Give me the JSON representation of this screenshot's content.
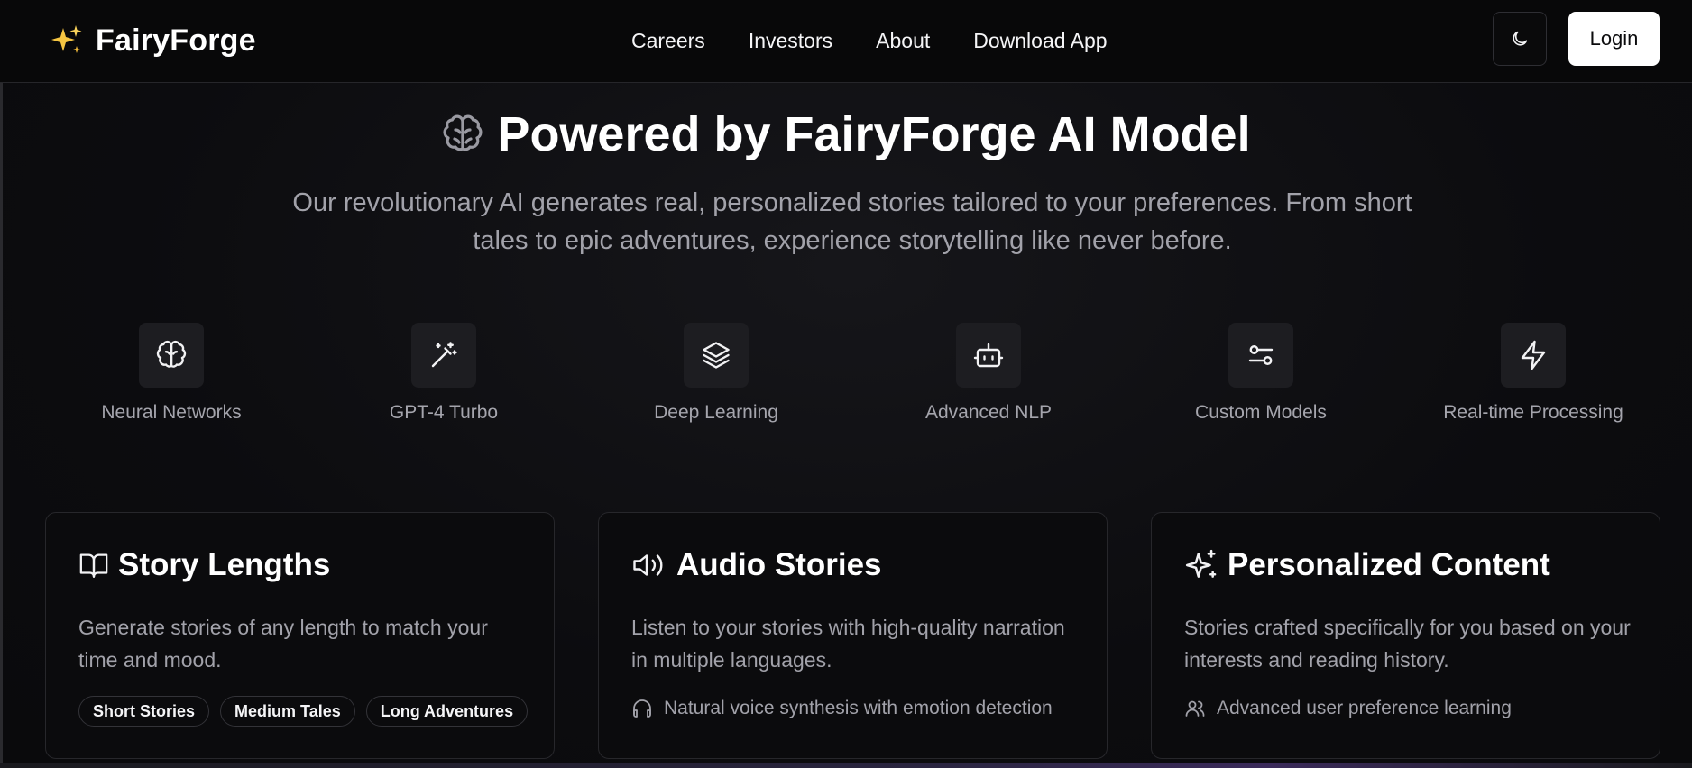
{
  "header": {
    "brand_name": "FairyForge",
    "brand_icon": "sparkles-icon",
    "nav": [
      "Careers",
      "Investors",
      "About",
      "Download App"
    ],
    "theme_toggle_icon": "moon-icon",
    "login_label": "Login"
  },
  "hero": {
    "icon": "brain-icon",
    "title": "Powered by FairyForge AI Model",
    "subtitle": "Our revolutionary AI generates real, personalized stories tailored to your preferences. From short tales to epic adventures, experience storytelling like never before."
  },
  "features": [
    {
      "label": "Neural Networks",
      "icon": "brain-icon"
    },
    {
      "label": "GPT-4 Turbo",
      "icon": "magic-wand-icon"
    },
    {
      "label": "Deep Learning",
      "icon": "layers-icon"
    },
    {
      "label": "Advanced NLP",
      "icon": "bot-icon"
    },
    {
      "label": "Custom Models",
      "icon": "sliders-icon"
    },
    {
      "label": "Real-time Processing",
      "icon": "lightning-icon"
    }
  ],
  "cards": [
    {
      "title": "Story Lengths",
      "icon": "book-open-icon",
      "description": "Generate stories of any length to match your time and mood.",
      "pills": [
        "Short Stories",
        "Medium Tales",
        "Long Adventures"
      ]
    },
    {
      "title": "Audio Stories",
      "icon": "speaker-icon",
      "description": "Listen to your stories with high-quality narration in multiple languages.",
      "note": "Natural voice synthesis with emotion detection",
      "note_icon": "headphones-icon"
    },
    {
      "title": "Personalized Content",
      "icon": "sparkles-outline-icon",
      "description": "Stories crafted specifically for you based on your interests and reading history.",
      "note": "Advanced user preference learning",
      "note_icon": "users-icon"
    }
  ],
  "colors": {
    "background": "#0b0b0d",
    "text": "#ffffff",
    "muted_text": "#a2a2aa",
    "brand_icon": "#f5c542"
  }
}
